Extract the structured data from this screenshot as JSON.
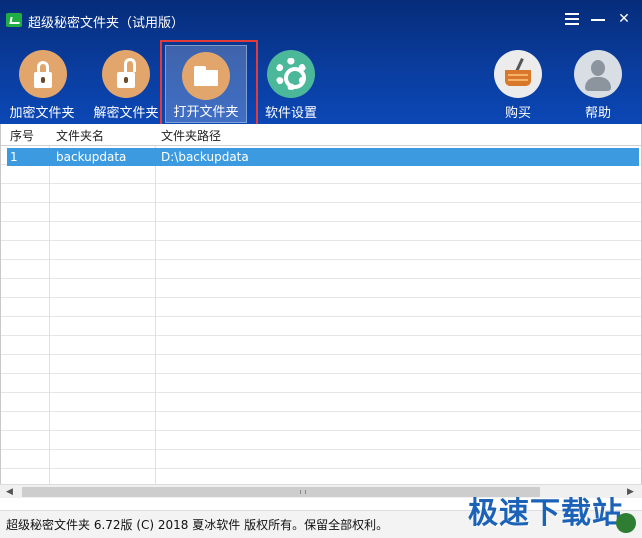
{
  "window": {
    "title": "超级秘密文件夹（试用版）",
    "controls": {
      "menu": "menu-icon",
      "minimize": "minimize-icon",
      "close": "✕"
    }
  },
  "toolbar": {
    "encrypt_label": "加密文件夹",
    "decrypt_label": "解密文件夹",
    "open_label": "打开文件夹",
    "settings_label": "软件设置",
    "buy_label": "购买",
    "help_label": "帮助"
  },
  "table": {
    "columns": [
      "序号",
      "文件夹名",
      "文件夹路径"
    ],
    "rows": [
      {
        "index": "1",
        "name": "backupdata",
        "path": "D:\\backupdata",
        "selected": true
      }
    ]
  },
  "scrollbar": {
    "left_arrow": "◀",
    "right_arrow": "▶"
  },
  "status": {
    "text": "超级秘密文件夹 6.72版 (C) 2018 夏冰软件 版权所有。保留全部权利。"
  },
  "watermark": {
    "text": "极速下载站"
  },
  "colors": {
    "header": "#0a3d9e",
    "selection": "#3c9be0",
    "highlight_border": "#e33a3a",
    "watermark": "#1c63b8"
  }
}
